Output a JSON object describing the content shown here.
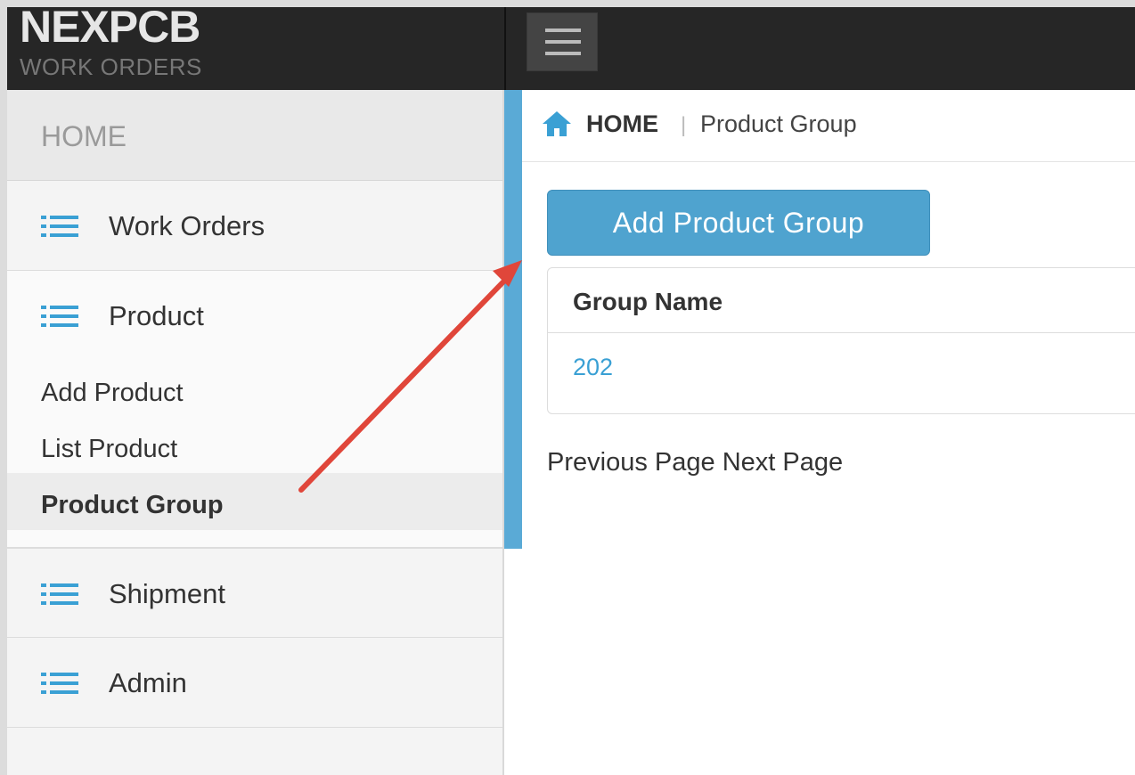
{
  "brand": {
    "name": "NEXPCB",
    "subtitle": "WORK ORDERS"
  },
  "sidebar": {
    "home_label": "HOME",
    "items": [
      {
        "label": "Work Orders"
      },
      {
        "label": "Product"
      },
      {
        "label": "Shipment"
      },
      {
        "label": "Admin"
      }
    ],
    "product_sub": [
      "Add Product",
      "List Product",
      "Product Group"
    ]
  },
  "breadcrumb": {
    "home": "HOME",
    "separator": "|",
    "current": "Product Group"
  },
  "main": {
    "add_button_label": "Add Product Group",
    "table": {
      "header": "Group Name",
      "rows": [
        "202"
      ]
    },
    "pager": {
      "previous": "Previous Page",
      "next": "Next Page"
    }
  },
  "colors": {
    "accent": "#4fa3cf",
    "link": "#3aa0d4",
    "annotation_arrow": "#e0463a",
    "topbar": "#262626"
  },
  "icons": {
    "menu": "hamburger-icon",
    "nav": "list-icon",
    "home": "home-icon",
    "annotation": "red-arrow-annotation"
  }
}
